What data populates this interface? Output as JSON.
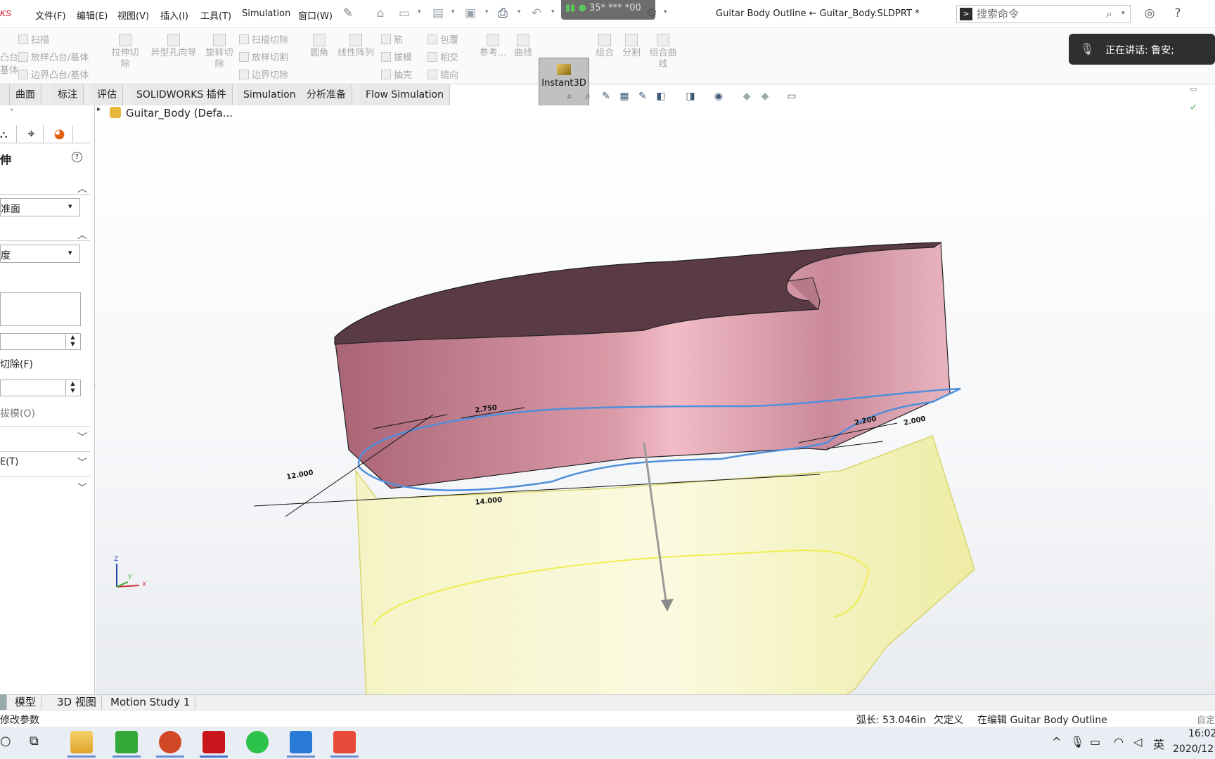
{
  "app": {
    "logo_text": "KS",
    "window_title": "Guitar Body Outline ← Guitar_Body.SLDPRT *",
    "record_indicator": "35* *** *00"
  },
  "menu": [
    {
      "label": "文件(F)"
    },
    {
      "label": "编辑(E)"
    },
    {
      "label": "视图(V)"
    },
    {
      "label": "插入(I)"
    },
    {
      "label": "工具(T)"
    },
    {
      "label": "Simulation"
    },
    {
      "label": "窗口(W)"
    }
  ],
  "search": {
    "placeholder": "搜索命令"
  },
  "speaking": {
    "text": "正在讲话: 鲁安;"
  },
  "command_manager": {
    "col1": [
      "扫描",
      "放样凸台/基体",
      "边界凸台/基体"
    ],
    "col1_partial": [
      "凸台",
      "基体"
    ],
    "extrude_cut": "拉伸切除",
    "hole_wizard": "异型孔向导",
    "revolve_cut": "旋转切除",
    "col2": [
      "扫描切除",
      "放样切割",
      "边界切除"
    ],
    "fillet": "圆角",
    "linear_pattern": "线性阵列",
    "col3": [
      "筋",
      "拔模",
      "抽壳"
    ],
    "col4": [
      "包覆",
      "相交",
      "镜向"
    ],
    "reference": "参考...",
    "curves": "曲线",
    "instant3d": "Instant3D",
    "combine": "组合",
    "split": "分割",
    "composite_curve": "组合曲线"
  },
  "tabs": [
    {
      "label": "曲面"
    },
    {
      "label": "标注"
    },
    {
      "label": "评估"
    },
    {
      "label": "SOLIDWORKS 插件"
    },
    {
      "label": "Simulation"
    },
    {
      "label": "分析准备"
    },
    {
      "label": "Flow Simulation"
    }
  ],
  "left_panel": {
    "dot": "°",
    "title": "伸",
    "help": "?",
    "from_value": "准面",
    "direction_value": "度",
    "flip_cut": "切除(F)",
    "draft": "拔模(O)",
    "thin_feature": "E(T)"
  },
  "tree": {
    "root": "Guitar_Body  (Defa..."
  },
  "sketch_dims": {
    "d1": "2.750",
    "d2": "12.000",
    "d3": "14.000",
    "d4": "2.200",
    "d5": "2.000"
  },
  "triad": {
    "x": "X",
    "y": "Y",
    "z": "Z"
  },
  "bottom_tabs": [
    {
      "label": "模型"
    },
    {
      "label": "3D 视图"
    },
    {
      "label": "Motion Study 1"
    }
  ],
  "status": {
    "hint": "修改参数",
    "arc_length": "弧长: 53.046in",
    "state": "欠定义",
    "editing": "在编辑 Guitar Body Outline",
    "custom": "自定"
  },
  "taskbar": {
    "ime": "英",
    "time": "16:02",
    "date": "2020/12"
  },
  "colors": {
    "solid_body": "#c27f8e",
    "solid_top": "#5a3a45",
    "preview_body": "#f3f1b6",
    "sketch": "#4f8fdb"
  }
}
